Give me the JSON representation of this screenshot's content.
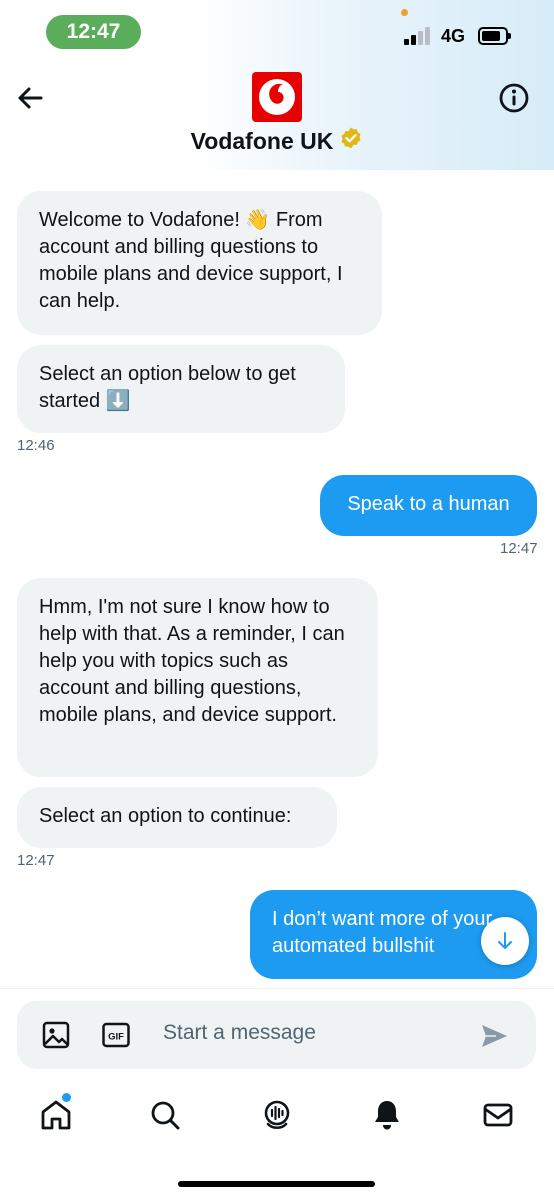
{
  "status_bar": {
    "time": "12:47",
    "network": "4G"
  },
  "header": {
    "name": "Vodafone UK",
    "back_icon": "back-arrow-icon",
    "info_icon": "info-icon",
    "brand_color": "#e60000"
  },
  "messages": [
    {
      "from": "bot",
      "text": "Welcome to Vodafone! 👋 From account and billing questions to mobile plans and device support, I can help."
    },
    {
      "from": "bot",
      "text": "Select an option below to get started ⬇️"
    },
    {
      "from": "bot_time",
      "text": "12:46"
    },
    {
      "from": "user",
      "text": "Speak to a human"
    },
    {
      "from": "user_time",
      "text": "12:47"
    },
    {
      "from": "bot",
      "text": "Hmm, I'm not sure I know how to help with that. As a reminder, I can help you with topics such as account and billing questions, mobile plans, and device support."
    },
    {
      "from": "bot",
      "text": "Select an option to continue:"
    },
    {
      "from": "bot_time",
      "text": "12:47"
    },
    {
      "from": "user",
      "text": "I don’t want more of your automated bullshit"
    }
  ],
  "composer": {
    "placeholder": "Start a message",
    "gif_label": "GIF"
  },
  "tab_bar": [
    "home-icon",
    "search-icon",
    "spaces-icon",
    "notifications-icon",
    "messages-icon"
  ],
  "colors": {
    "accent": "#1d9bf0",
    "bubble_in": "#eff3f4",
    "status_pill": "#5aad5a"
  }
}
